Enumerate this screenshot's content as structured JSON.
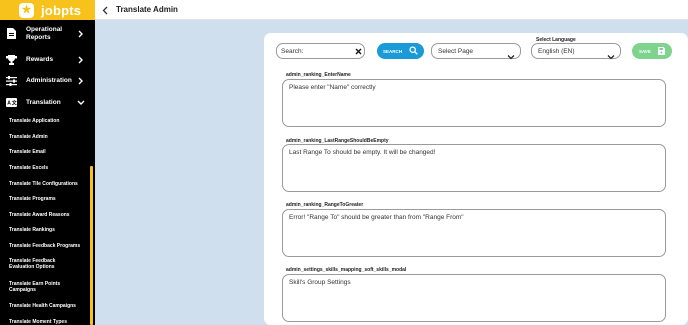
{
  "brand": {
    "name": "jobpts",
    "badge_glyph": "★",
    "color": "#f7c21b"
  },
  "topbar": {
    "title": "Translate Admin"
  },
  "sidebar": {
    "items": [
      {
        "label_lines": [
          "Operational",
          "Reports"
        ],
        "icon": "report-icon",
        "expanded": false
      },
      {
        "label_lines": [
          "Rewards"
        ],
        "icon": "trophy-icon",
        "expanded": false
      },
      {
        "label_lines": [
          "Administration"
        ],
        "icon": "sliders-icon",
        "expanded": false
      },
      {
        "label_lines": [
          "Translation"
        ],
        "icon": "translate-icon",
        "expanded": true
      }
    ],
    "translation_subitems": [
      [
        "Translate Application"
      ],
      [
        "Translate Admin"
      ],
      [
        "Translate Email"
      ],
      [
        "Translate Excels"
      ],
      [
        "Translate Tile Configurations"
      ],
      [
        "Translate Programs"
      ],
      [
        "Translate Award Reasons"
      ],
      [
        "Translate Rankings"
      ],
      [
        "Translate Feedback Programs"
      ],
      [
        "Translate Feedback",
        "Evaluation Options"
      ],
      [
        "Translate Earn Points",
        "Campaigns"
      ],
      [
        "Translate Health Campaigns"
      ],
      [
        "Translate Moment Types"
      ]
    ]
  },
  "toolbar": {
    "search_placeholder": "Search:",
    "search_button": "SEARCH",
    "page_select": "Select Page",
    "language_label": "Select Language",
    "language_value": "English (EN)",
    "save_button": "SAVE"
  },
  "fields": [
    {
      "key": "admin_ranking_EnterName",
      "value": "Please enter \"Name\" correctly"
    },
    {
      "key": "admin_ranking_LastRangeShouldBeEmpty",
      "value": "Last Range To should be empty. It will be changed!"
    },
    {
      "key": "admin_ranking_RangeToGreater",
      "value": "Error! \"Range To\" should be greater than from \"Range From\""
    },
    {
      "key": "admin_settings_skills_mapping_soft_skills_modal",
      "value": "Skill's Group Settings"
    }
  ],
  "colors": {
    "accent_yellow": "#f7c21b",
    "search_blue": "#1a9bd7",
    "save_green": "#7ed38f",
    "content_bg": "#cfdfed"
  }
}
